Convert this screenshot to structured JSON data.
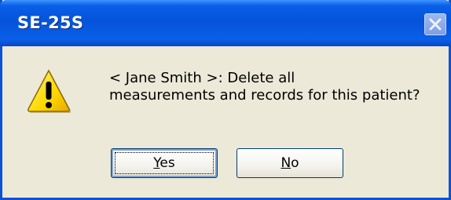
{
  "window": {
    "title": "SE-25S"
  },
  "dialog": {
    "icon": "warning-icon",
    "message_line1": "< Jane Smith >: Delete all",
    "message_line2": "measurements and records for this patient?"
  },
  "buttons": {
    "yes_first": "Y",
    "yes_rest": "es",
    "no_first": "N",
    "no_rest": "o"
  },
  "colors": {
    "titlebar": "#0553da",
    "dialog_bg": "#ece9d8",
    "warning_fill": "#ffd800"
  }
}
